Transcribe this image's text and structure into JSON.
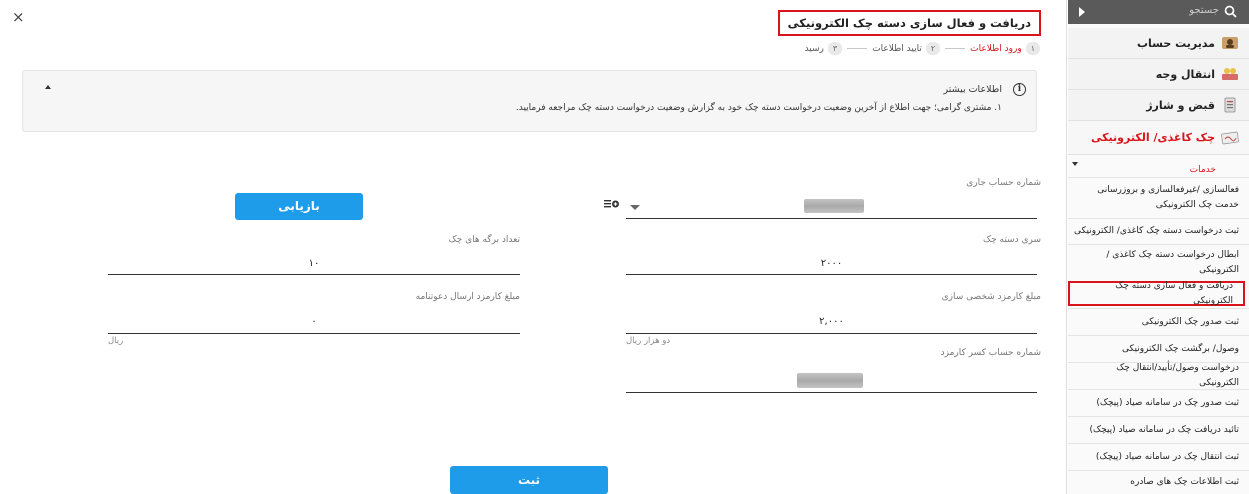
{
  "dialog": {
    "title": "دریافت و فعال سازی دسته چک الکترونیکی",
    "close_label": "×",
    "steps": [
      {
        "num": "۱",
        "label": "ورود اطلاعات",
        "active": true
      },
      {
        "num": "۲",
        "label": "تایید اطلاعات",
        "active": false
      },
      {
        "num": "۳",
        "label": "رسید",
        "active": false
      }
    ]
  },
  "info": {
    "title": "اطلاعات بیشتر",
    "text": "۱. مشتری گرامی؛ جهت اطلاع از آخرین وضعیت درخواست دسته چک خود به گزارش وضعیت درخواست دسته چک مراجعه فرمایید."
  },
  "form": {
    "account_label": "شماره حساب جاری",
    "retrieve_button": "بازیابی",
    "series_label": "سری دسته چک",
    "series_value": "۲۰۰۰",
    "sheets_label": "تعداد برگه های چک",
    "sheets_value": "۱۰",
    "fee_label": "مبلغ کارمزد شخصی سازی",
    "fee_value": "۲,۰۰۰",
    "fee_words": "دو هزار ریال",
    "invite_fee_label": "مبلغ کارمزد ارسال دعوتنامه",
    "invite_fee_value": "۰",
    "invite_fee_unit": "ریال",
    "deduct_account_label": "شماره حساب کسر کارمزد",
    "submit_button": "ثبت"
  },
  "sidebar": {
    "search_placeholder": "جستجو",
    "menu": [
      {
        "label": "مدیریت حساب",
        "icon": "account-management-icon"
      },
      {
        "label": "انتقال وجه",
        "icon": "money-transfer-icon"
      },
      {
        "label": "قبض و شارژ",
        "icon": "bill-charge-icon"
      },
      {
        "label": "چک کاغذی/ الکترونیکی",
        "icon": "cheque-icon",
        "active": true
      }
    ],
    "services_title": "خدمات",
    "services": [
      "فعالسازی /غیرفعالسازی و بروزرسانی خدمت چک الکترونیکی",
      "ثبت درخواست دسته چک کاغذی/ الکترونیکی",
      "ابطال درخواست دسته چک کاغذی / الکترونیکی",
      "دریافت و فعال سازی دسته چک الکترونیکی",
      "ثبت صدور چک الکترونیکی",
      "وصول/ برگشت چک الکترونیکی",
      "درخواست وصول/تأیید/انتقال چک الکترونیکی",
      "ثبت صدور چک در سامانه صیاد (پیچک)",
      "تائید دریافت چک در سامانه صیاد (پیچک)",
      "ثبت انتقال چک در سامانه صیاد (پیچک)",
      "ثبت اطلاعات چک های صادره"
    ]
  },
  "colors": {
    "accent_red": "#d9141b",
    "button_blue": "#1e9be9",
    "sidebar_search_bg": "#5a5a5a"
  }
}
